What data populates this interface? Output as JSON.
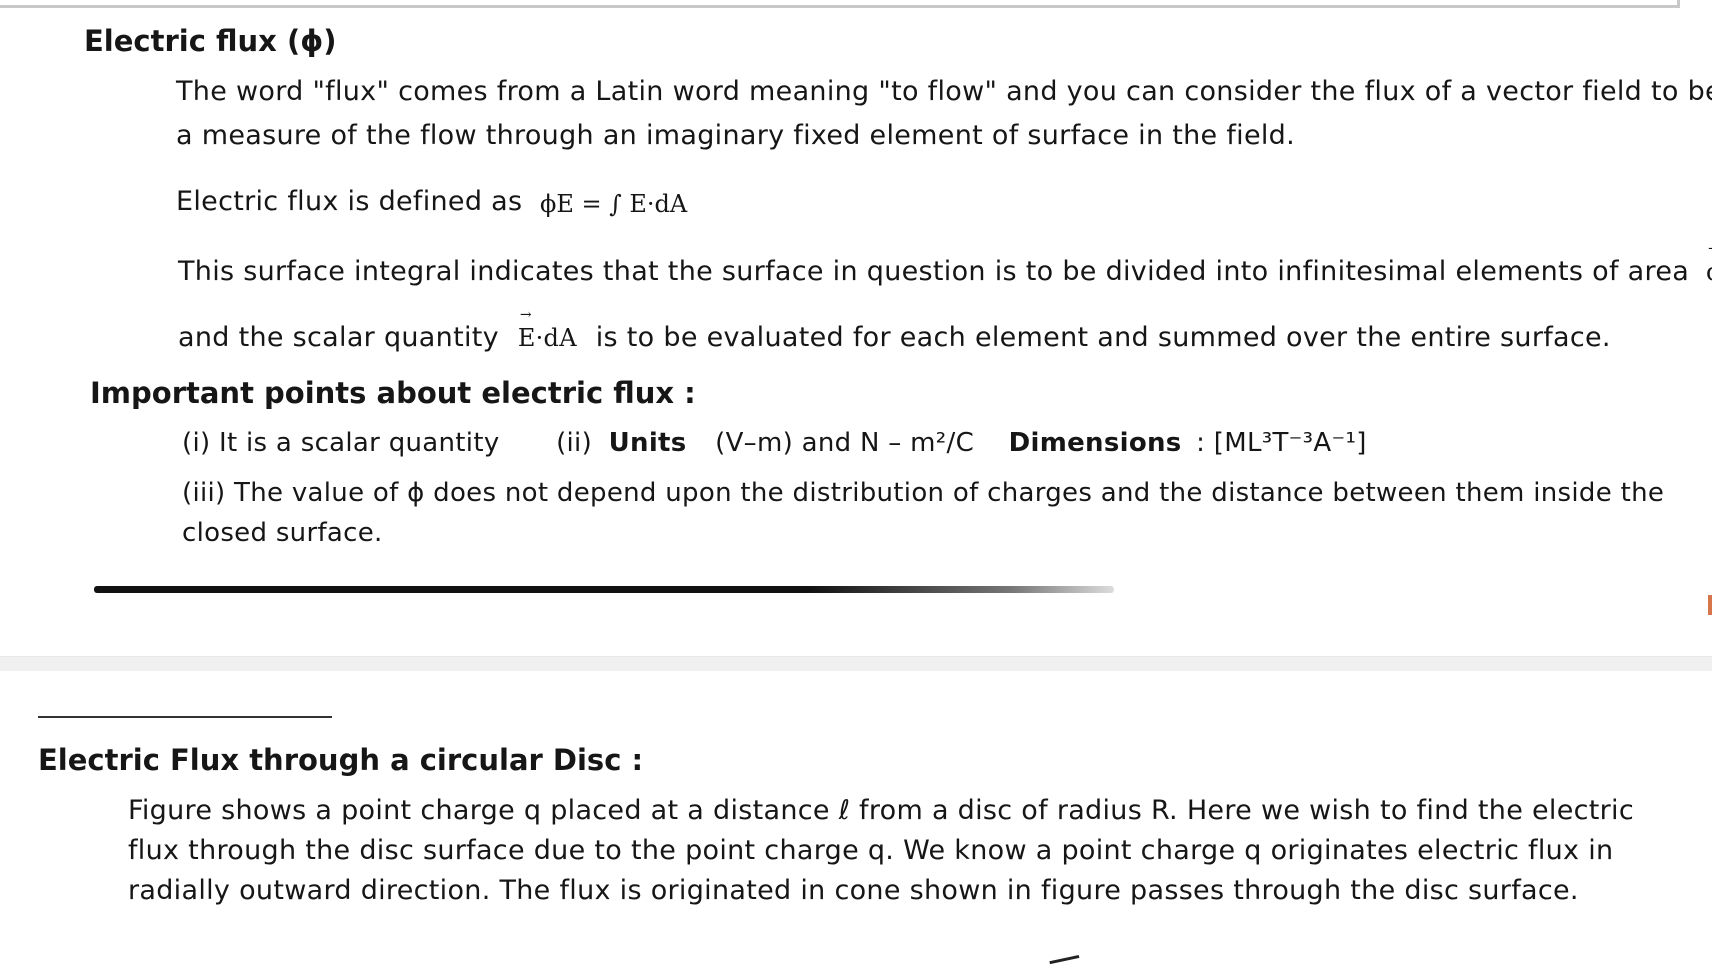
{
  "page1": {
    "heading": "Electric flux (ϕ)",
    "intro_line1": "The  word \"flux\" comes from a Latin word meaning \"to flow\" and you can consider the flux of a vector field to be",
    "intro_line2": "a measure of the flow through an imaginary fixed element of surface in the field.",
    "definition_label": "Electric flux is defined as",
    "definition_formula": "ϕE = ∫ E·dA",
    "integral_line1": "This surface integral indicates that the surface in question is to be divided into infinitesimal elements of area",
    "integral_line1_symbol": "dA",
    "integral_line2_pre": "and the scalar quantity",
    "integral_line2_symbol": "E·dA",
    "integral_line2_post": "is to be evaluated for each element and summed over the entire surface.",
    "points_heading": "Important points about electric flux :",
    "point1": "(i) It is a scalar quantity",
    "point2_label": "(ii)",
    "point2_units_label": "Units",
    "point2_units_value": "(V–m) and N – m²/C",
    "point2_dimensions_label": "Dimensions",
    "point2_dimensions_value": ": [ML³T⁻³A⁻¹]",
    "point3_line1": "(iii) The value of ϕ does not depend upon the distribution of charges and the distance between them inside the",
    "point3_line2": "closed surface."
  },
  "page2": {
    "heading": "Electric Flux through a circular Disc :",
    "line1": "Figure shows a point charge q placed at a distance ℓ from a disc of radius R. Here we wish to find the electric",
    "line2": "flux through the disc surface due to the point charge q. We know a point charge q originates electric flux in",
    "line3": "radially outward direction. The flux   is originated  in cone shown in figure passes through  the disc surface."
  }
}
